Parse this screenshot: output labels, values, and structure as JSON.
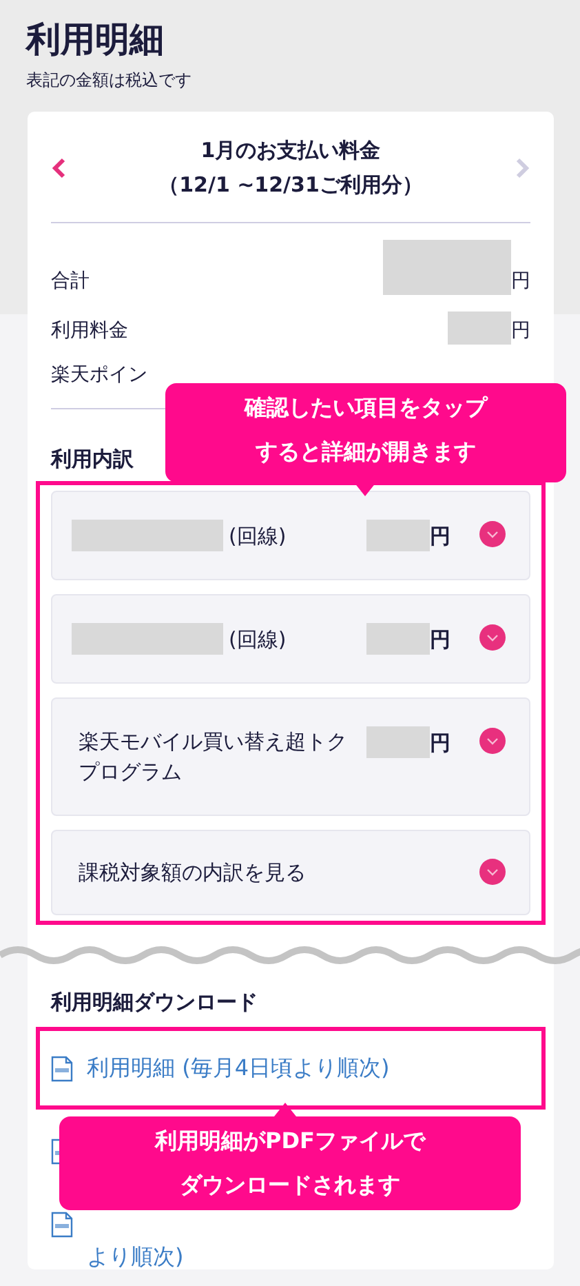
{
  "page": {
    "title": "利用明細",
    "note": "表記の金額は税込です"
  },
  "billing": {
    "title": "1月のお支払い料金",
    "period": "（12/1 ~12/31ご利用分）",
    "prev_enabled": true,
    "next_enabled": false
  },
  "summary": [
    {
      "kind": "total",
      "label": "合計",
      "unit": "円"
    },
    {
      "kind": "row",
      "label": "利用料金",
      "unit": "円"
    },
    {
      "kind": "covered",
      "label": "楽天ポイン"
    }
  ],
  "breakdown": {
    "title": "利用内訳",
    "highlighted": true,
    "items": [
      {
        "kind": "line",
        "label": "(回線)",
        "unit": "円",
        "expanded": false
      },
      {
        "kind": "line",
        "label": "(回線)",
        "unit": "円",
        "expanded": false
      },
      {
        "kind": "program",
        "label": "楽天モバイル買い替え超トクプログラム",
        "unit": "円",
        "expanded": false
      },
      {
        "kind": "link",
        "label": "課税対象額の内訳を見る",
        "expanded": false
      }
    ]
  },
  "download": {
    "title": "利用明細ダウンロード",
    "links": [
      {
        "kind": "full",
        "label": "利用明細 (毎月4日頃より順次)",
        "highlighted": true
      },
      {
        "kind": "icon_only",
        "highlighted": false
      },
      {
        "kind": "tail",
        "label": "より順次)",
        "highlighted": false
      }
    ]
  },
  "callouts": [
    {
      "kind": "down",
      "lines": [
        "確認したい項目をタップ",
        "すると詳細が開きます"
      ]
    },
    {
      "kind": "up",
      "lines": [
        "利用明細がPDFファイルで",
        "ダウンロードされます"
      ]
    }
  ]
}
